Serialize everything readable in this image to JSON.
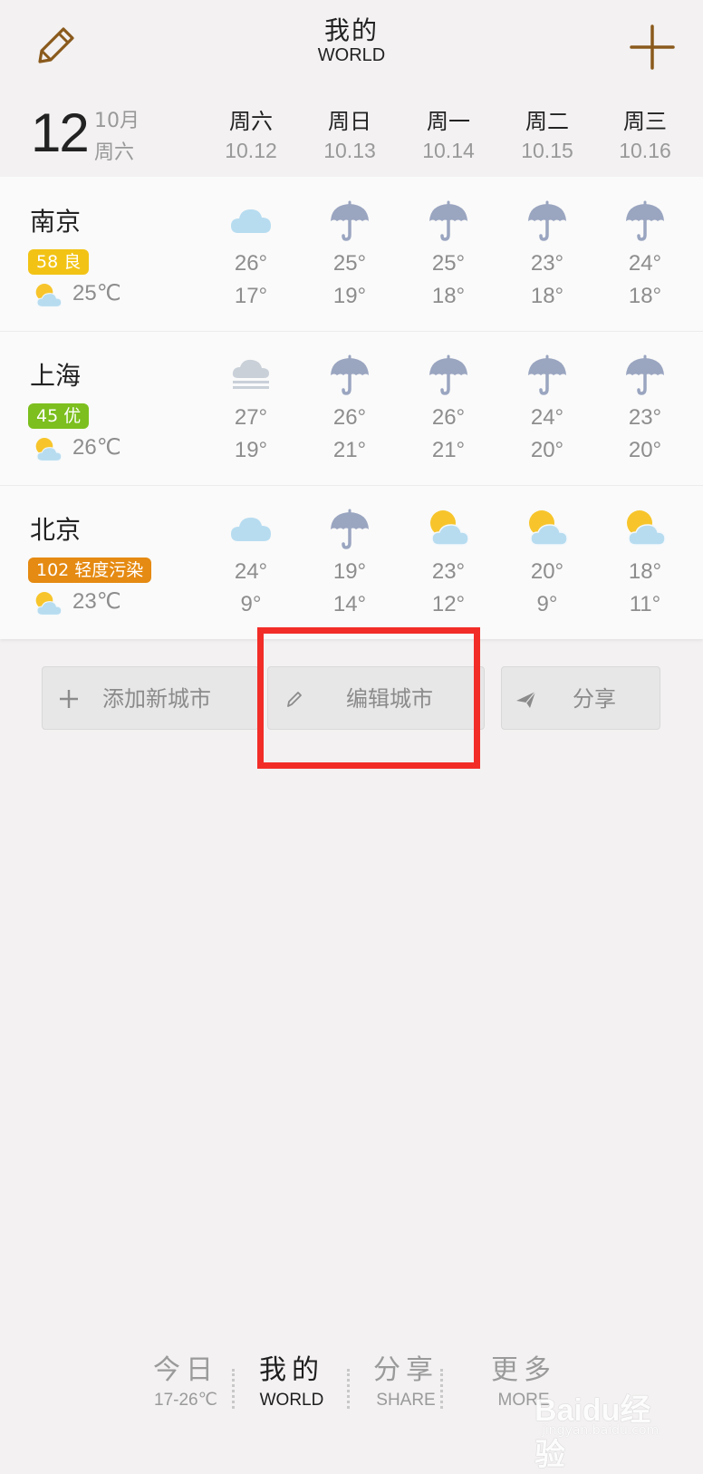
{
  "header": {
    "title_cn": "我的",
    "title_en": "WORLD",
    "edit_icon": "pencil-icon",
    "add_icon": "plus-icon"
  },
  "today": {
    "day": "12",
    "month": "10月",
    "weekday": "周六"
  },
  "days": [
    {
      "weekday": "周六",
      "date": "10.12"
    },
    {
      "weekday": "周日",
      "date": "10.13"
    },
    {
      "weekday": "周一",
      "date": "10.14"
    },
    {
      "weekday": "周二",
      "date": "10.15"
    },
    {
      "weekday": "周三",
      "date": "10.16"
    }
  ],
  "cities": [
    {
      "name": "南京",
      "aqi": "58 良",
      "aqi_color": "#f2c315",
      "current_icon": "partly-cloudy-icon",
      "current_temp": "25℃",
      "forecast": [
        {
          "icon": "cloudy-icon",
          "high": "26°",
          "low": "17°"
        },
        {
          "icon": "rain-umbrella-icon",
          "high": "25°",
          "low": "19°"
        },
        {
          "icon": "rain-umbrella-icon",
          "high": "25°",
          "low": "18°"
        },
        {
          "icon": "rain-umbrella-icon",
          "high": "23°",
          "low": "18°"
        },
        {
          "icon": "rain-umbrella-icon",
          "high": "24°",
          "low": "18°"
        }
      ]
    },
    {
      "name": "上海",
      "aqi": "45 优",
      "aqi_color": "#7cbf1e",
      "current_icon": "partly-cloudy-icon",
      "current_temp": "26℃",
      "forecast": [
        {
          "icon": "fog-icon",
          "high": "27°",
          "low": "19°"
        },
        {
          "icon": "rain-umbrella-icon",
          "high": "26°",
          "low": "21°"
        },
        {
          "icon": "rain-umbrella-icon",
          "high": "26°",
          "low": "21°"
        },
        {
          "icon": "rain-umbrella-icon",
          "high": "24°",
          "low": "20°"
        },
        {
          "icon": "rain-umbrella-icon",
          "high": "23°",
          "low": "20°"
        }
      ]
    },
    {
      "name": "北京",
      "aqi": "102 轻度污染",
      "aqi_color": "#e58a12",
      "current_icon": "partly-cloudy-icon",
      "current_temp": "23℃",
      "forecast": [
        {
          "icon": "cloudy-icon",
          "high": "24°",
          "low": "9°"
        },
        {
          "icon": "rain-umbrella-icon",
          "high": "19°",
          "low": "14°"
        },
        {
          "icon": "partly-cloudy-icon",
          "high": "23°",
          "low": "12°"
        },
        {
          "icon": "partly-cloudy-icon",
          "high": "20°",
          "low": "9°"
        },
        {
          "icon": "partly-cloudy-icon",
          "high": "18°",
          "low": "11°"
        }
      ]
    }
  ],
  "actions": {
    "add_city": "添加新城市",
    "edit_city": "编辑城市",
    "share": "分享"
  },
  "tabs": [
    {
      "cn": "今日",
      "en": "17-26℃",
      "active": false
    },
    {
      "cn": "我的",
      "en": "WORLD",
      "active": true
    },
    {
      "cn": "分享",
      "en": "SHARE",
      "active": false
    },
    {
      "cn": "更多",
      "en": "MORE",
      "active": false
    }
  ],
  "watermark": {
    "logo": "Baidu经验",
    "url": "jingyan.baidu.com"
  },
  "colors": {
    "accent_brown": "#8a5a1c",
    "highlight_red": "#f22d28",
    "umbrella": "#9aa5c0",
    "cloud": "#b7dcf0",
    "sun": "#f7c52b"
  }
}
